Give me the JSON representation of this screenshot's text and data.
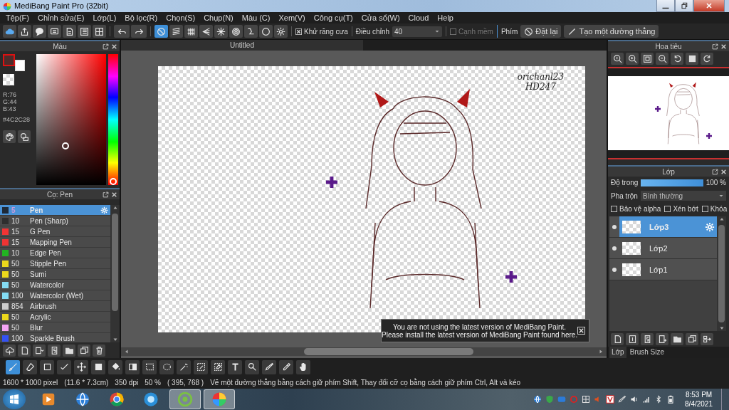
{
  "window": {
    "title": "MediBang Paint Pro (32bit)"
  },
  "menu": [
    "Tệp(F)",
    "Chỉnh sửa(E)",
    "Lớp(L)",
    "Bộ lọc(R)",
    "Chọn(S)",
    "Chụp(N)",
    "Màu (C)",
    "Xem(V)",
    "Công cụ(T)",
    "Cửa sổ(W)",
    "Cloud",
    "Help"
  ],
  "toolbar": {
    "file_tools": [
      {
        "kind": "cloud"
      },
      {
        "kind": "share"
      },
      {
        "kind": "speech-bubble"
      },
      {
        "kind": "comment"
      },
      {
        "kind": "document"
      },
      {
        "kind": "list"
      },
      {
        "kind": "grid"
      }
    ],
    "history_tools": [
      {
        "kind": "undo"
      },
      {
        "kind": "redo"
      }
    ],
    "ruler_tools": [
      {
        "kind": "prohibit",
        "selected": true
      },
      {
        "kind": "parallel-lines",
        "selected": false
      },
      {
        "kind": "grid-lines",
        "selected": false
      },
      {
        "kind": "perspective",
        "selected": false
      },
      {
        "kind": "radial",
        "selected": false
      },
      {
        "kind": "concentric",
        "selected": false
      },
      {
        "kind": "curve",
        "selected": false
      },
      {
        "kind": "circle",
        "selected": false
      },
      {
        "kind": "gear",
        "selected": false
      }
    ],
    "antialias": {
      "label": "Khử răng cưa",
      "checked": true
    },
    "correction": {
      "label": "Điều chỉnh",
      "value": "40"
    },
    "soft_edge": {
      "label": "Cạnh mềm",
      "checked": false,
      "disabled": true
    },
    "keys_label": "Phím",
    "reset_button": "Đặt lại",
    "straight_line_button": "Tạo một đường thẳng"
  },
  "color_panel": {
    "title": "Màu",
    "primary_swatch": {
      "color": "#4c2c2b"
    },
    "secondary_swatch": {
      "color": "#ffffff"
    },
    "hue_slider": {
      "level": 0
    },
    "rgb": [
      "R:76",
      "G:44",
      "B:43"
    ],
    "hex": "#4C2C28"
  },
  "brush_panel": {
    "title": "Cọ: Pen",
    "brushes": [
      {
        "size": "5",
        "name": "Pen",
        "color": "#1e2a38",
        "selected": true
      },
      {
        "size": "10",
        "name": "Pen (Sharp)",
        "color": "#2e2e2e",
        "selected": false
      },
      {
        "size": "15",
        "name": "G Pen",
        "color": "#f03434",
        "selected": false
      },
      {
        "size": "15",
        "name": "Mapping Pen",
        "color": "#f03434",
        "selected": false
      },
      {
        "size": "10",
        "name": "Edge Pen",
        "color": "#22b422",
        "selected": false
      },
      {
        "size": "50",
        "name": "Stipple Pen",
        "color": "#ecd81c",
        "selected": false
      },
      {
        "size": "50",
        "name": "Sumi",
        "color": "#ecd81c",
        "selected": false
      },
      {
        "size": "50",
        "name": "Watercolor",
        "color": "#84dcf4",
        "selected": false
      },
      {
        "size": "100",
        "name": "Watercolor (Wet)",
        "color": "#84dcf4",
        "selected": false
      },
      {
        "size": "854",
        "name": "Airbrush",
        "color": "#cccccc",
        "selected": false
      },
      {
        "size": "50",
        "name": "Acrylic",
        "color": "#ecd81c",
        "selected": false
      },
      {
        "size": "50",
        "name": "Blur",
        "color": "#f4a4f4",
        "selected": false
      },
      {
        "size": "100",
        "name": "Sparkle Brush",
        "color": "#3452f4",
        "selected": false
      }
    ],
    "tools": [
      {
        "kind": "cloud-upload"
      },
      {
        "kind": "new-document"
      },
      {
        "kind": "document-dropdown"
      },
      {
        "kind": "script-document"
      },
      {
        "kind": "folder"
      },
      {
        "kind": "duplicate"
      },
      {
        "kind": "trash"
      }
    ]
  },
  "canvas": {
    "tab": "Untitled",
    "signature": [
      "orichanl23",
      "HD247"
    ],
    "notice": [
      "You are not using the latest version of MediBang Paint.",
      "Please install the latest version of MediBang Paint found here."
    ]
  },
  "navigator": {
    "title": "Hoa tiêu",
    "tools": [
      {
        "kind": "zoom-reset"
      },
      {
        "kind": "zoom-in"
      },
      {
        "kind": "fit-screen"
      },
      {
        "kind": "zoom-out"
      },
      {
        "kind": "rotate-left"
      },
      {
        "kind": "filled-square"
      },
      {
        "kind": "rotate-right"
      }
    ]
  },
  "layer_panel": {
    "title": "Lớp",
    "opacity_label": "Độ trong",
    "opacity": {
      "level": 1
    },
    "opacity_reading": "100 %",
    "blend_label": "Pha trộn",
    "blend_value": "Bình thường",
    "options": [
      {
        "label": "Bảo vệ alpha",
        "checked": false
      },
      {
        "label": "Xén bớt",
        "checked": false
      },
      {
        "label": "Khóa",
        "checked": false
      }
    ],
    "layers": [
      {
        "name": "Lớp3",
        "selected": true,
        "visible": true
      },
      {
        "name": "Lớp2",
        "selected": false,
        "visible": true
      },
      {
        "name": "Lớp1",
        "selected": false,
        "visible": true
      }
    ],
    "tools": [
      {
        "kind": "new-document"
      },
      {
        "kind": "layer-numbered"
      },
      {
        "kind": "script-document"
      },
      {
        "kind": "new-layer"
      },
      {
        "kind": "folder"
      },
      {
        "kind": "duplicate"
      },
      {
        "kind": "merge-layers"
      }
    ],
    "tabs": [
      {
        "label": "Lớp",
        "selected": true
      },
      {
        "label": "Brush Size",
        "selected": false
      }
    ]
  },
  "bottom_tools": [
    {
      "kind": "brush",
      "selected": true
    },
    {
      "kind": "eraser",
      "selected": false
    },
    {
      "kind": "square",
      "selected": false
    },
    {
      "kind": "tick",
      "selected": false
    },
    {
      "kind": "move",
      "selected": false
    },
    {
      "kind": "filled-square",
      "selected": false
    },
    {
      "kind": "bucket",
      "selected": false
    },
    {
      "kind": "gradient",
      "selected": false
    },
    {
      "kind": "select-rect",
      "selected": false
    },
    {
      "kind": "lasso",
      "selected": false
    },
    {
      "kind": "magic-wand",
      "selected": false
    },
    {
      "kind": "select-pen",
      "selected": false
    },
    {
      "kind": "select-eraser",
      "selected": false
    },
    {
      "kind": "text",
      "selected": false
    },
    {
      "kind": "pointer",
      "selected": false
    },
    {
      "kind": "pen",
      "selected": false
    },
    {
      "kind": "eyedropper",
      "selected": false
    },
    {
      "kind": "hand",
      "selected": false
    }
  ],
  "status_bar": {
    "items": [
      "1600 * 1000 pixel",
      "(11.6 * 7.3cm)",
      "350 dpi",
      "50 %",
      "( 395, 768 )"
    ],
    "hint": "Vẽ một đường thẳng bằng cách giữ phím Shift, Thay đổi cỡ cọ bằng cách giữ phím Ctrl, Alt và kéo"
  },
  "taskbar": {
    "apps": [
      {
        "kind": "play",
        "running": false
      },
      {
        "kind": "globe",
        "running": false
      },
      {
        "kind": "tricolor-circle",
        "running": false
      },
      {
        "kind": "disc",
        "running": false
      },
      {
        "kind": "swirl",
        "running": true
      },
      {
        "kind": "color-wheel",
        "running": true
      }
    ],
    "tray": [
      {
        "kind": "globe"
      },
      {
        "kind": "shield"
      },
      {
        "kind": "chat"
      },
      {
        "kind": "ring"
      },
      {
        "kind": "grid"
      },
      {
        "kind": "speaker"
      },
      {
        "kind": "v-box"
      },
      {
        "kind": "pen"
      },
      {
        "kind": "volume"
      },
      {
        "kind": "signal"
      },
      {
        "kind": "bluetooth"
      },
      {
        "kind": "battery"
      }
    ],
    "time": "8:53 PM",
    "date": "8/4/2021"
  }
}
